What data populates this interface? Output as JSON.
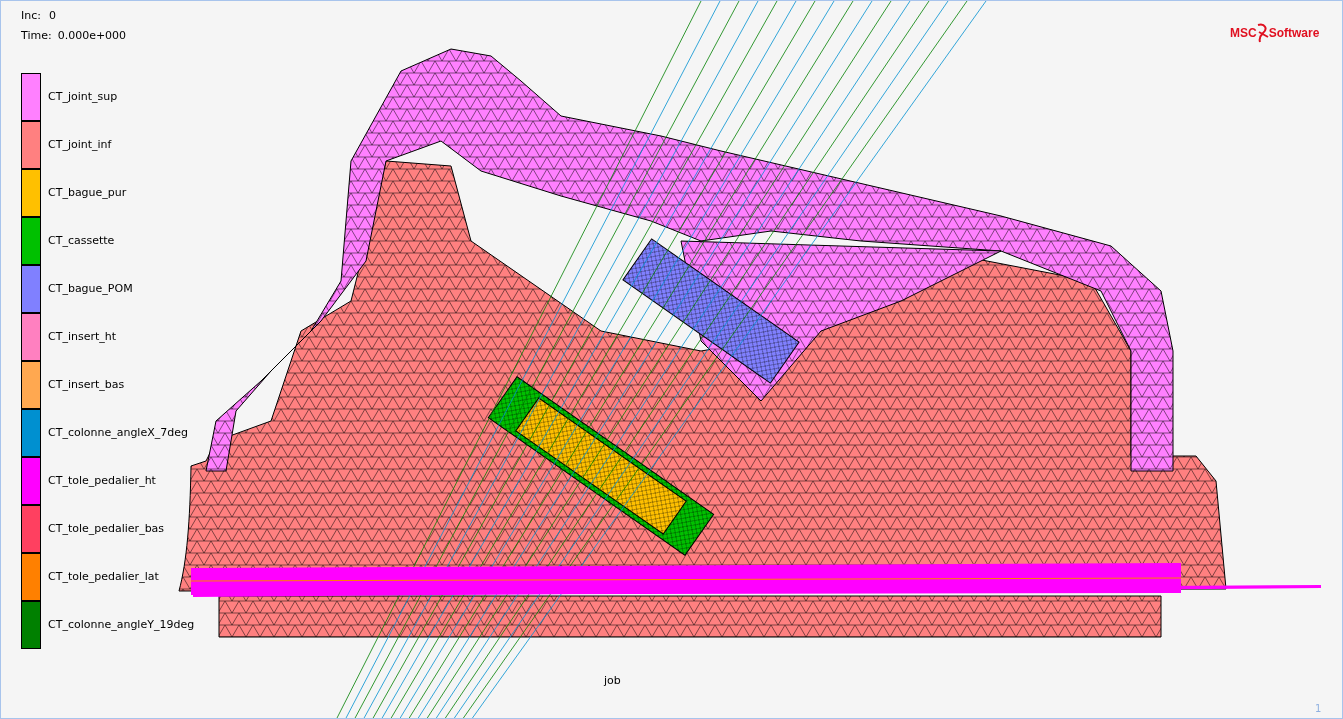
{
  "header": {
    "increment_label": "Inc:",
    "increment": "0",
    "time_label": "Time:",
    "time": "0.000e+000"
  },
  "logo": {
    "left": "MSC",
    "right": "Software"
  },
  "legend": [
    {
      "label": "CT_joint_sup",
      "color": "#ff80ff"
    },
    {
      "label": "CT_joint_inf",
      "color": "#ff8080"
    },
    {
      "label": "CT_bague_pur",
      "color": "#ffc000"
    },
    {
      "label": "CT_cassette",
      "color": "#00c000"
    },
    {
      "label": "CT_bague_POM",
      "color": "#8080ff"
    },
    {
      "label": "CT_insert_ht",
      "color": "#ff80c0"
    },
    {
      "label": "CT_insert_bas",
      "color": "#ffa850"
    },
    {
      "label": "CT_colonne_angleX_7deg",
      "color": "#0090d0"
    },
    {
      "label": "CT_tole_pedalier_ht",
      "color": "#ff00ff"
    },
    {
      "label": "CT_tole_pedalier_bas",
      "color": "#ff4060"
    },
    {
      "label": "CT_tole_pedalier_lat",
      "color": "#ff8000"
    },
    {
      "label": "CT_colonne_angleY_19deg",
      "color": "#008000"
    }
  ],
  "viewport_label": "job",
  "page_number": "1"
}
